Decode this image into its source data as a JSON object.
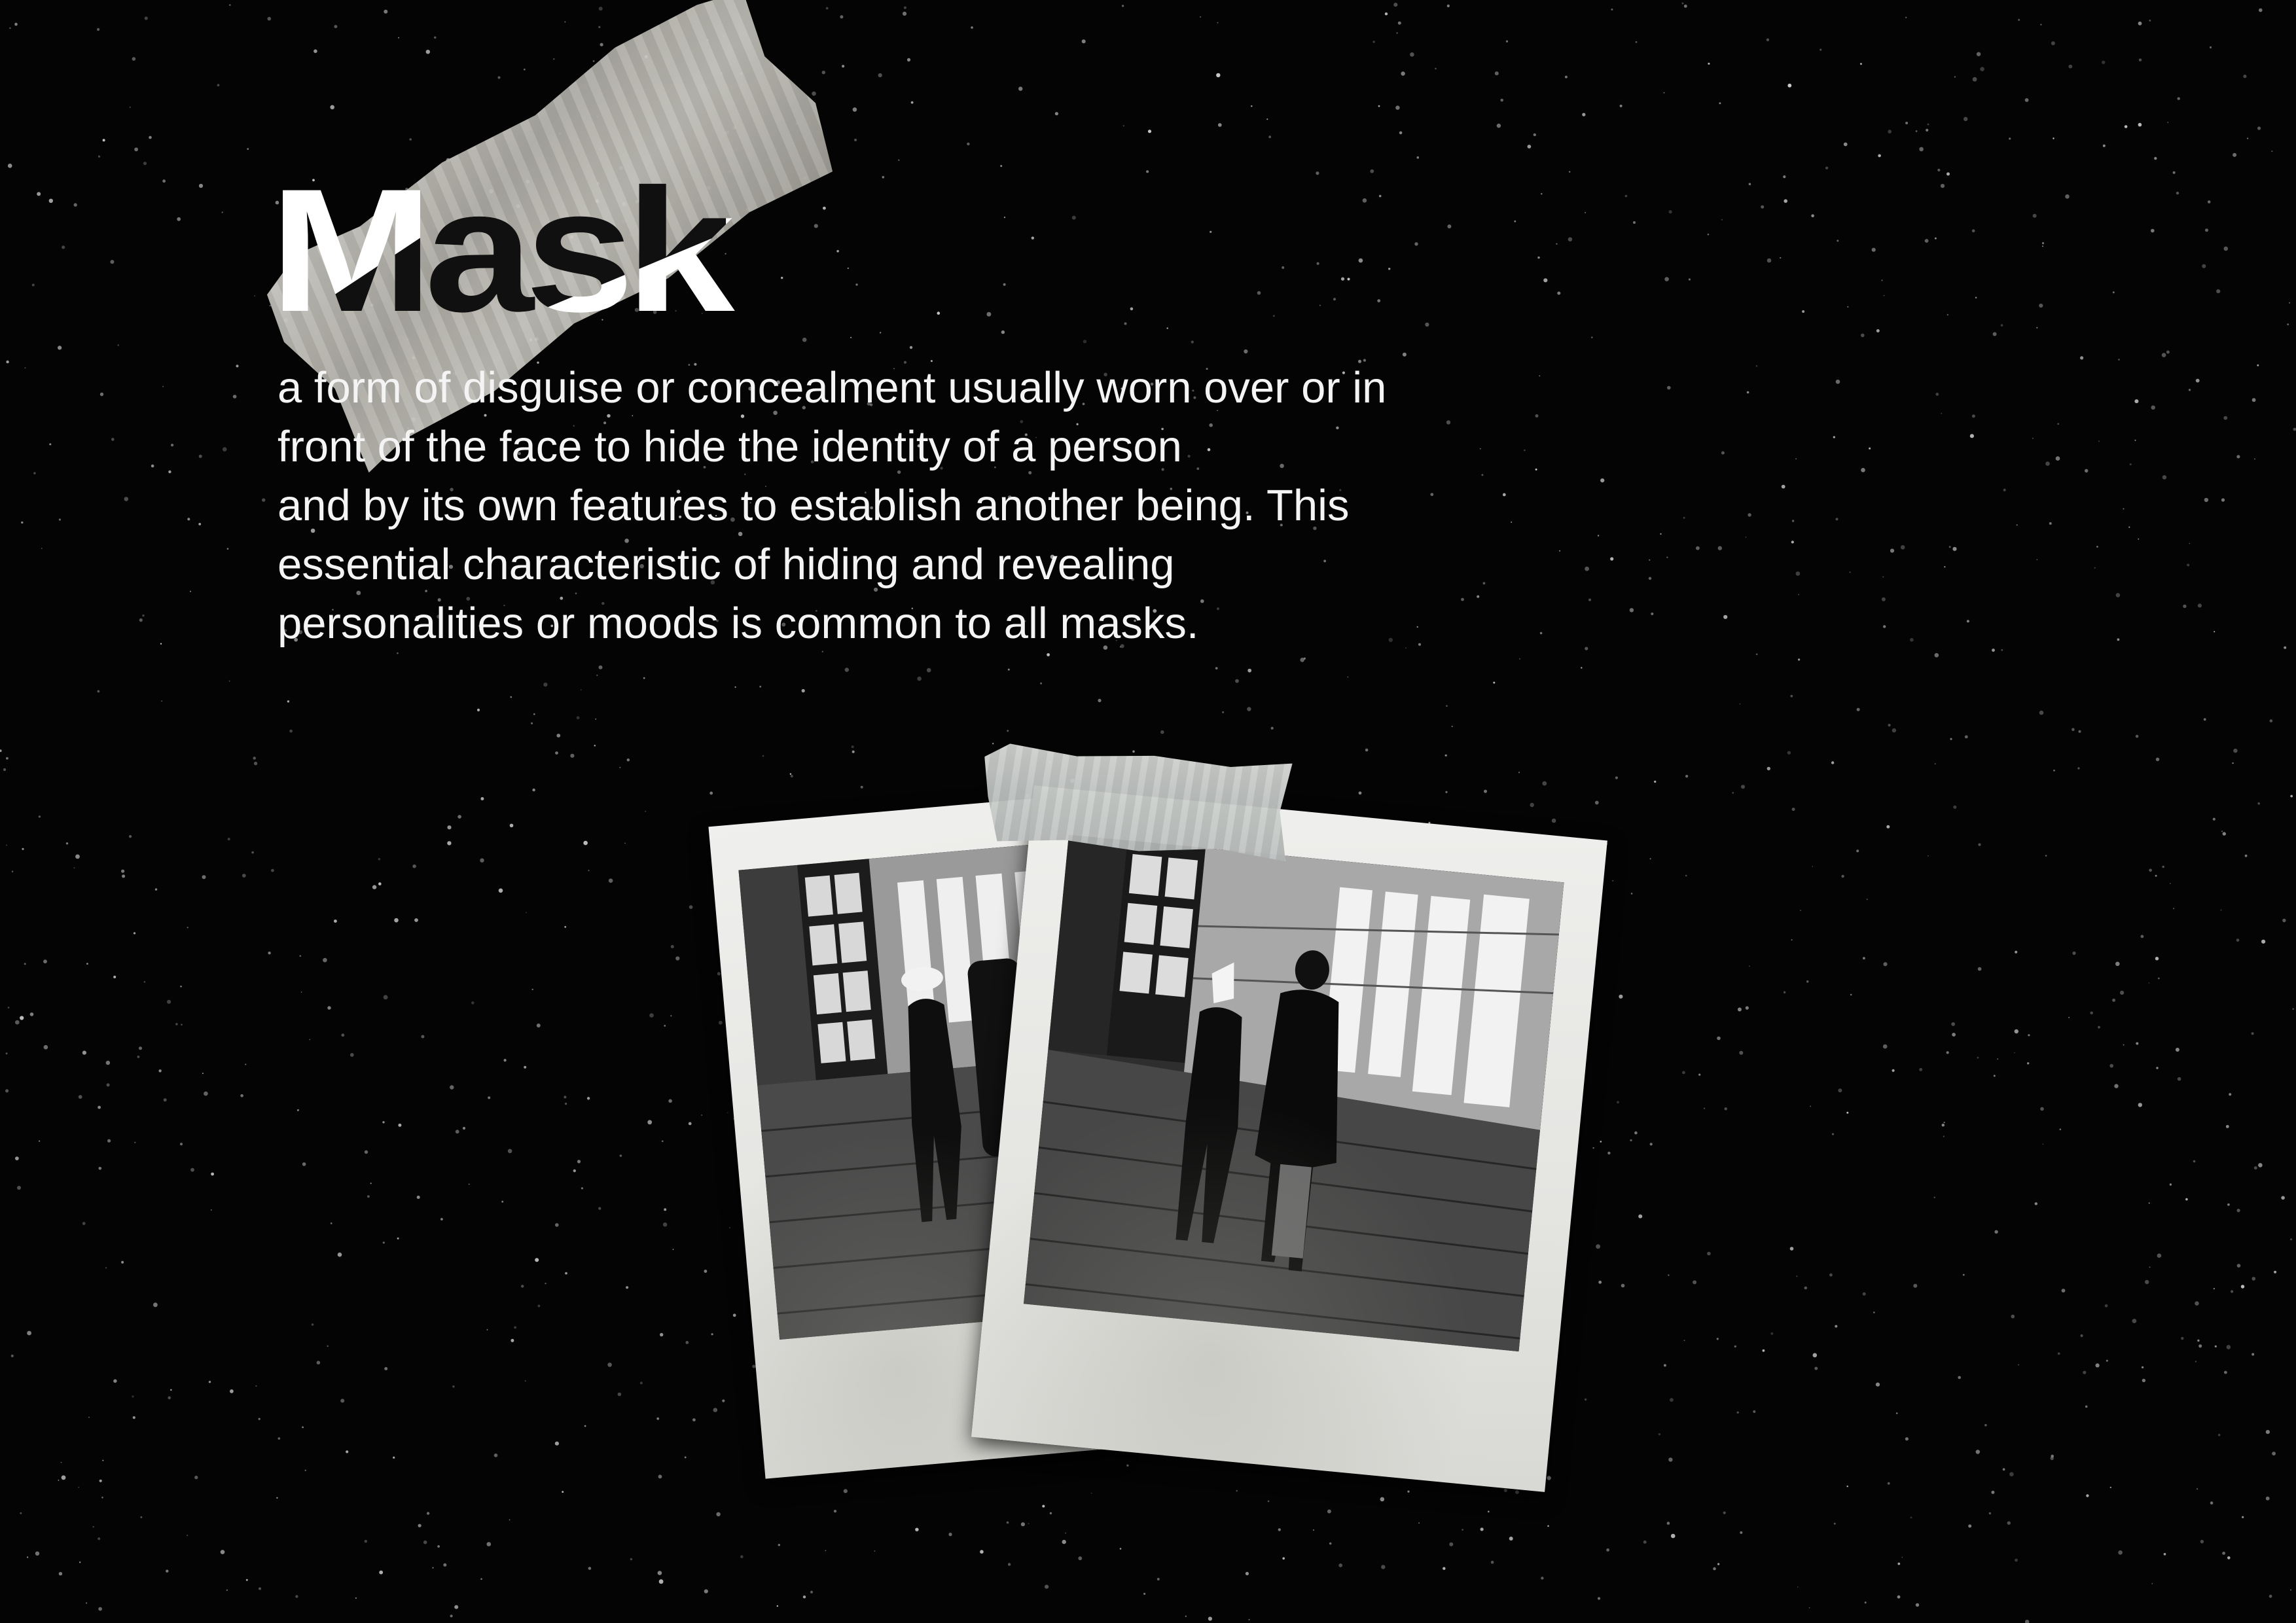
{
  "title": "Mask",
  "definition": {
    "lines": [
      "a form of disguise or concealment usually worn over or in",
      "front of the face to hide the identity of a person",
      "and by its own features to establish another being. This",
      "essential characteristic of hiding and revealing",
      "personalities or moods is common to all masks."
    ]
  },
  "colors": {
    "background": "#040404",
    "text": "#f4f4f4",
    "polaroid_frame": "#e8e8e5",
    "tape": "#c6c4bc"
  },
  "images": [
    {
      "name": "polaroid-left",
      "subject": "black and white photo of two people walking on a brick path between buildings"
    },
    {
      "name": "polaroid-right",
      "subject": "black and white photo of a couple walking away on a brick path, one wearing a paper mask"
    }
  ]
}
